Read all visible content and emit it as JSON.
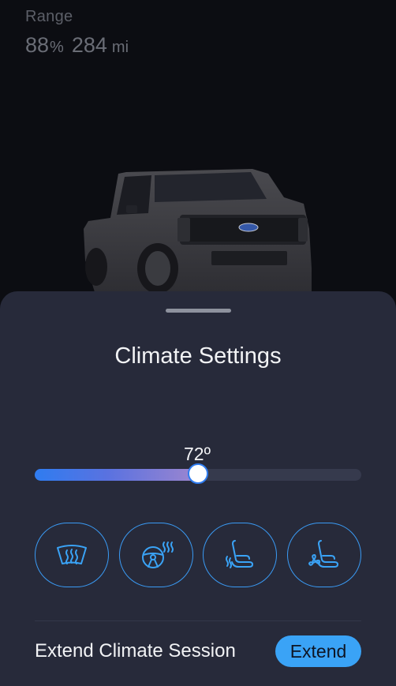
{
  "range": {
    "label": "Range",
    "percent": "88",
    "percent_unit": "%",
    "miles": "284",
    "miles_unit": "mi"
  },
  "vehicle": {
    "image": "truck-image"
  },
  "climate": {
    "title": "Climate Settings",
    "temperature": "72º",
    "slider_fraction": 0.5,
    "controls": [
      {
        "name": "defrost-button",
        "icon": "rear-defrost-icon"
      },
      {
        "name": "heated-steering-button",
        "icon": "heated-steering-wheel-icon"
      },
      {
        "name": "heated-seat-button",
        "icon": "heated-seat-icon"
      },
      {
        "name": "ventilated-seat-button",
        "icon": "ventilated-seat-icon"
      }
    ],
    "extend_label": "Extend Climate Session",
    "extend_button": "Extend"
  },
  "colors": {
    "accent": "#3aa3f6",
    "sheet": "#272a3a",
    "background": "#0c0d12"
  }
}
